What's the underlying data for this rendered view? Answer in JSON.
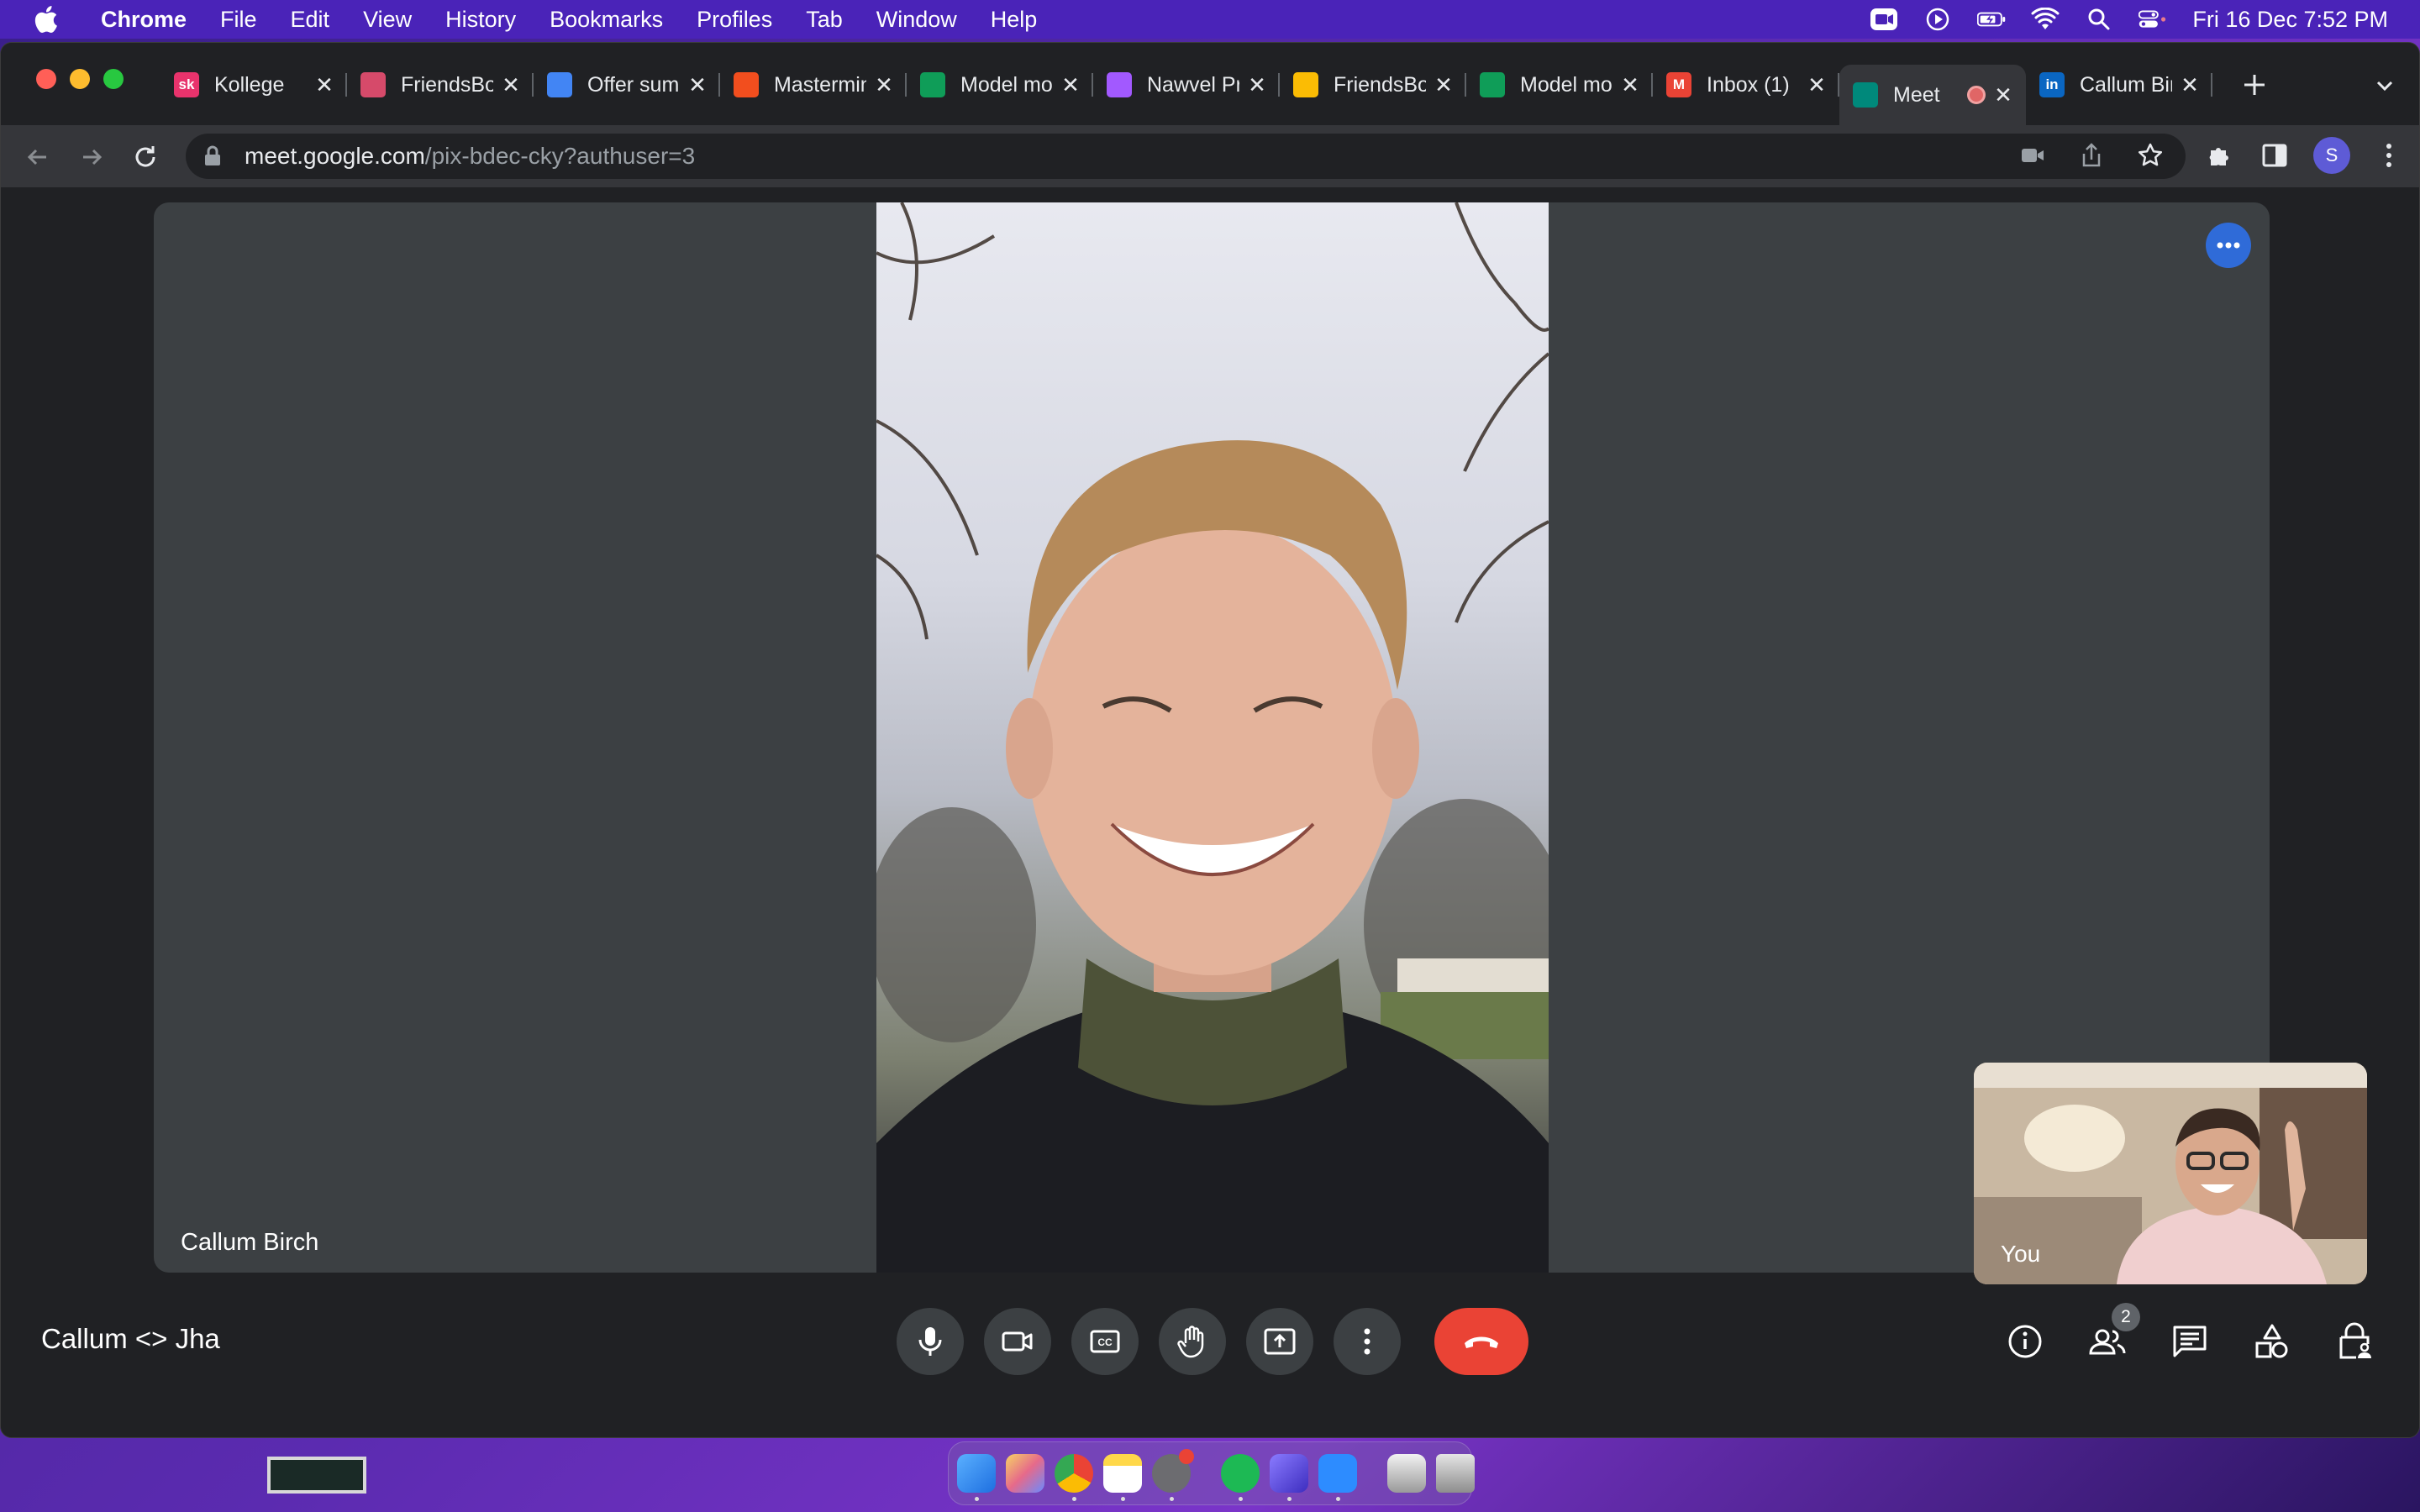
{
  "menubar": {
    "app_name": "Chrome",
    "items": [
      "File",
      "Edit",
      "View",
      "History",
      "Bookmarks",
      "Profiles",
      "Tab",
      "Window",
      "Help"
    ],
    "clock": "Fri 16 Dec  7:52 PM"
  },
  "tabs": [
    {
      "title": "Kollege",
      "favicon": "kollege-icon",
      "color": "#e8336c",
      "glyph": "sk"
    },
    {
      "title": "FriendsBoo",
      "favicon": "friends-icon",
      "color": "#d64a6a",
      "glyph": ""
    },
    {
      "title": "Offer sum",
      "favicon": "google-docs-icon",
      "color": "#4285f4",
      "glyph": ""
    },
    {
      "title": "Mastermind",
      "favicon": "figma-icon",
      "color": "#f24e1e",
      "glyph": ""
    },
    {
      "title": "Model mod",
      "favicon": "google-sheets-icon",
      "color": "#0f9d58",
      "glyph": ""
    },
    {
      "title": "Nawvel Pr",
      "favicon": "figma-icon",
      "color": "#a259ff",
      "glyph": ""
    },
    {
      "title": "FriendsBoo",
      "favicon": "google-drive-icon",
      "color": "#fbbc04",
      "glyph": ""
    },
    {
      "title": "Model mod",
      "favicon": "google-sheets-icon",
      "color": "#0f9d58",
      "glyph": ""
    },
    {
      "title": "Inbox (1)",
      "favicon": "gmail-icon",
      "color": "#ea4335",
      "glyph": "M"
    },
    {
      "title": "Meet",
      "favicon": "google-meet-icon",
      "color": "#00897b",
      "glyph": "",
      "active": true
    },
    {
      "title": "Callum Birch",
      "favicon": "linkedin-icon",
      "color": "#0a66c2",
      "glyph": "in"
    }
  ],
  "address_bar": {
    "host": "meet.google.com",
    "path": "/pix-bdec-cky?authuser=3"
  },
  "profile_initial": "S",
  "meet": {
    "participant_name": "Callum Birch",
    "self_label": "You",
    "meeting_title": "Callum <> Jha",
    "people_count": "2"
  },
  "colors": {
    "end_call": "#ea4335",
    "stage_bg": "#3c4043",
    "accent_blue": "#2f6bd8"
  }
}
